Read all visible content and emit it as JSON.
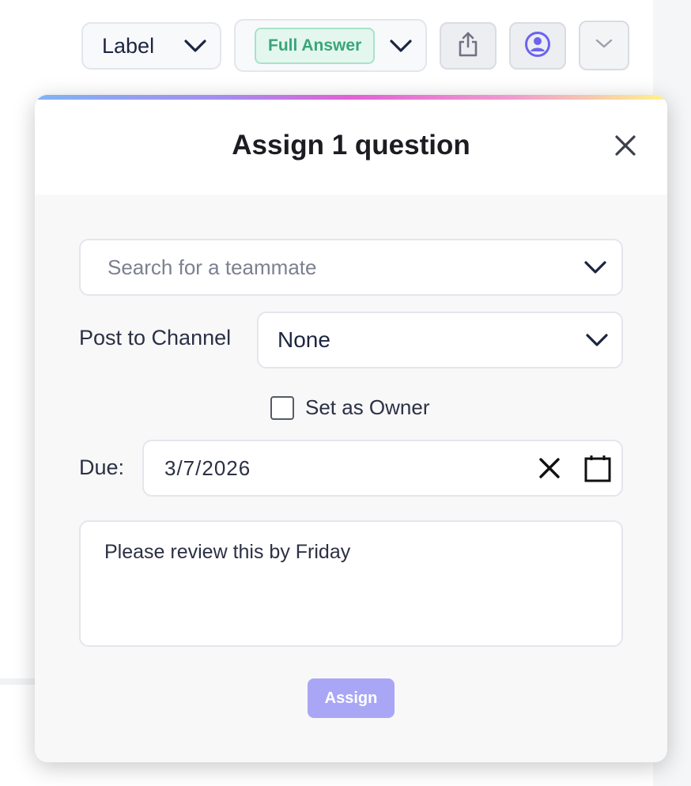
{
  "toolbar": {
    "label_select": "Label",
    "answer_badge": "Full Answer",
    "share_icon": "share-icon",
    "assign_icon": "user-circle-icon",
    "more_icon": "chevron-down-icon"
  },
  "modal": {
    "title": "Assign 1 question",
    "search_placeholder": "Search for a teammate",
    "channel_label": "Post to Channel",
    "channel_value": "None",
    "owner_label": "Set as Owner",
    "owner_checked": false,
    "due_label": "Due:",
    "due_value": "3/7/2026",
    "notes_value": "Please review this by Friday",
    "assign_button": "Assign"
  },
  "colors": {
    "accent": "#a9a7f5",
    "badge_text": "#3aa57a",
    "badge_bg": "#e3f7ee",
    "user_icon": "#6c63f0"
  }
}
